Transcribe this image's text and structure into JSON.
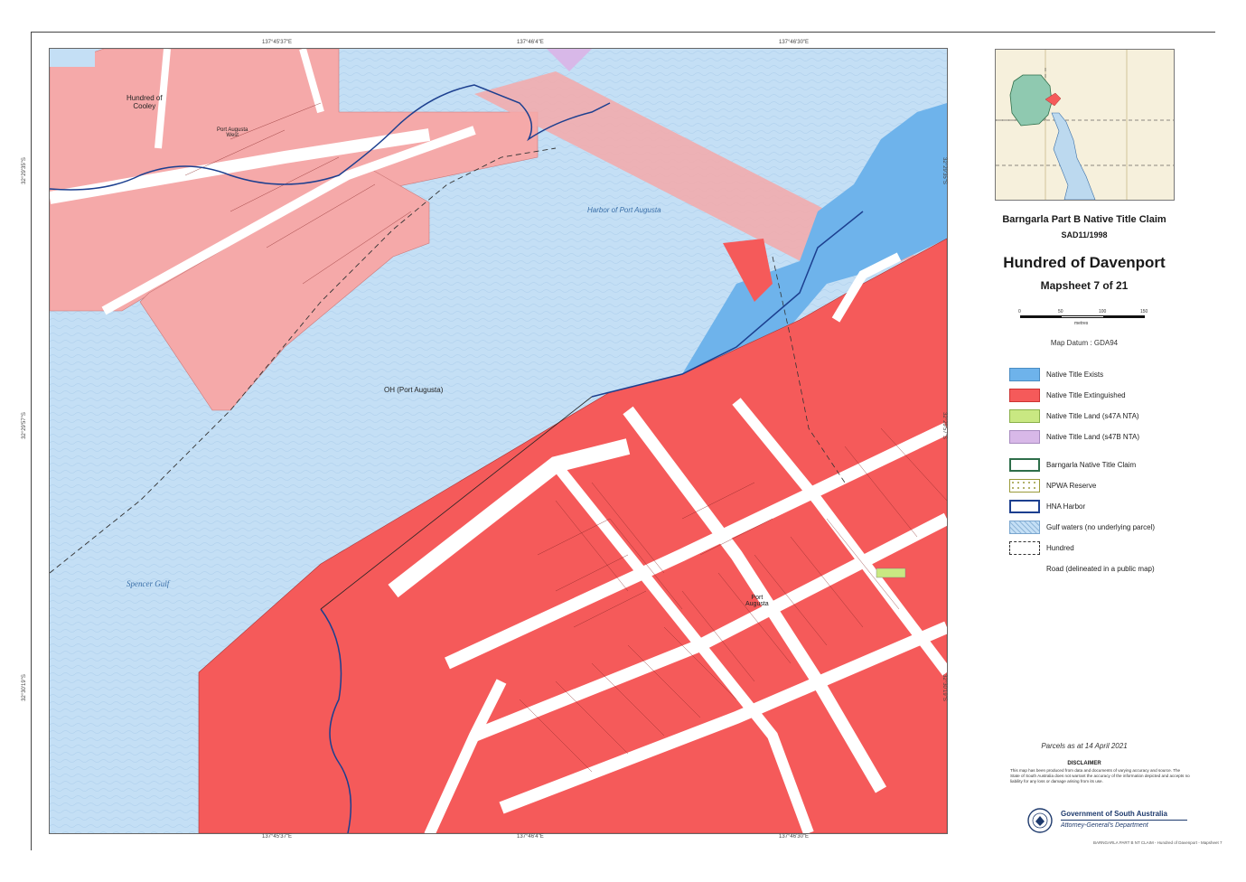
{
  "map": {
    "labels": {
      "hundred_cooley": "Hundred of\nCooley",
      "port_augusta_west": "Port Augusta\nWest",
      "harbor": "Harbor of Port Augusta",
      "oh": "OH (Port Augusta)",
      "spencer_gulf": "Spencer Gulf",
      "port_augusta": "Port\nAugusta"
    },
    "ticks": {
      "top": [
        "137°45'37\"E",
        "137°46'4\"E",
        "137°46'30\"E"
      ],
      "bottom": [
        "137°45'37\"E",
        "137°46'4\"E",
        "137°46'30\"E"
      ],
      "left": [
        "32°29'35\"S",
        "32°29'57\"S",
        "32°30'19\"S"
      ],
      "right": [
        "32°29'35\"S",
        "32°29'57\"S",
        "32°30'19\"S"
      ]
    }
  },
  "panel": {
    "claim_title": "Barngarla Part B Native Title Claim",
    "claim_code": "SAD11/1998",
    "hundred_title": "Hundred of Davenport",
    "mapsheet": "Mapsheet 7 of 21",
    "scale_labels": [
      "0",
      "50",
      "100",
      "150"
    ],
    "scale_unit": "metres",
    "datum": "Map Datum : GDA94",
    "legend": [
      {
        "label": "Native Title Exists",
        "color": "#6eb3eb",
        "kind": "fill"
      },
      {
        "label": "Native Title Extinguished",
        "color": "#f55a5a",
        "kind": "fill"
      },
      {
        "label": "Native Title Land (s47A NTA)",
        "color": "#c9e882",
        "kind": "fill"
      },
      {
        "label": "Native Title Land (s47B NTA)",
        "color": "#d8b8e8",
        "kind": "fill"
      },
      {
        "label": "Barngarla Native Title Claim",
        "color": "#2e6e4a",
        "kind": "outline"
      },
      {
        "label": "NPWA Reserve",
        "color": "#9a9a3a",
        "kind": "dotted"
      },
      {
        "label": "HNA Harbor",
        "color": "#1c3f8f",
        "kind": "outline"
      },
      {
        "label": "Gulf waters (no underlying parcel)",
        "color": "#c4dff5",
        "kind": "pattern"
      },
      {
        "label": "Hundred",
        "color": "#333333",
        "kind": "dashed"
      },
      {
        "label": "Road (delineated in a public map)",
        "color": "#ffffff",
        "kind": "none"
      }
    ],
    "parcels_date": "Parcels as at 14 April 2021",
    "disclaimer_title": "DISCLAIMER",
    "disclaimer_text": "This map has been produced from data and documents of varying accuracy and source. The State of South Australia does not warrant the accuracy of the information depicted and accepts no liability for any loss or damage arising from its use.",
    "gov_name": "Government of South Australia",
    "gov_dept": "Attorney-General's Department",
    "footer_code": "BARNGARLA PART B NT CLAIM - Hundred of Davenport - Mapsheet 7"
  }
}
